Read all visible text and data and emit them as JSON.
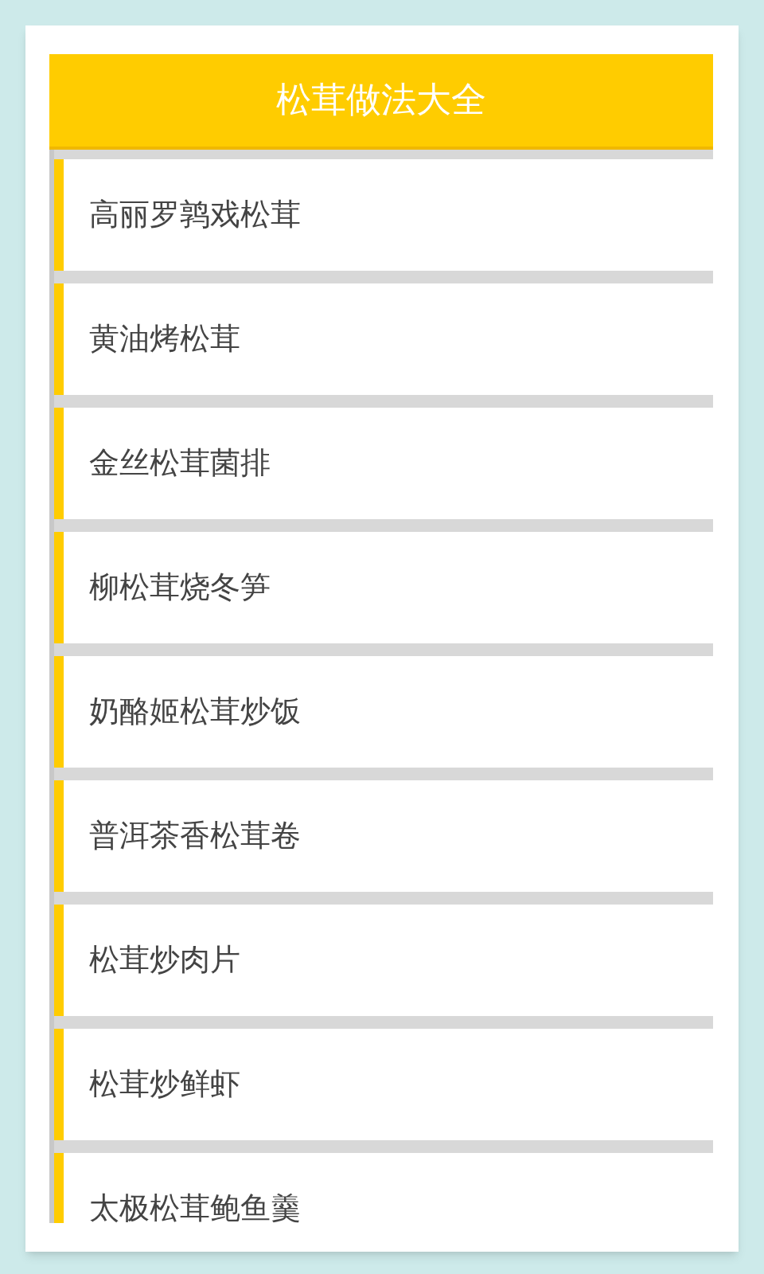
{
  "header": {
    "title": "松茸做法大全"
  },
  "recipes": [
    {
      "name": "高丽罗鹑戏松茸"
    },
    {
      "name": "黄油烤松茸"
    },
    {
      "name": "金丝松茸菌排"
    },
    {
      "name": "柳松茸烧冬笋"
    },
    {
      "name": "奶酪姬松茸炒饭"
    },
    {
      "name": "普洱茶香松茸卷"
    },
    {
      "name": "松茸炒肉片"
    },
    {
      "name": "松茸炒鲜虾"
    },
    {
      "name": "太极松茸鲍鱼羹"
    }
  ]
}
